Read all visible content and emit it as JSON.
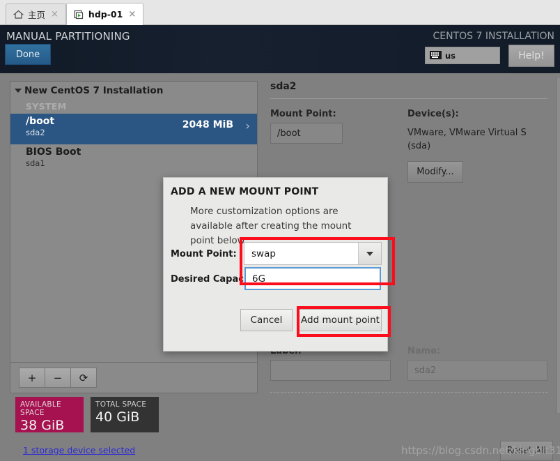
{
  "tabs": [
    {
      "label": "主页",
      "icon": "home-icon",
      "active": false,
      "close": "×"
    },
    {
      "label": "hdp-01",
      "icon": "vm-icon",
      "active": true,
      "close": "×"
    }
  ],
  "header": {
    "title": "MANUAL PARTITIONING",
    "product": "CENTOS 7 INSTALLATION",
    "done_label": "Done",
    "keyboard_layout": "us",
    "help_label": "Help!"
  },
  "partitions": {
    "group_title": "New CentOS 7 Installation",
    "section_label": "SYSTEM",
    "rows": [
      {
        "name": "/boot",
        "device": "sda2",
        "size": "2048 MiB",
        "selected": true,
        "chevron": "›"
      },
      {
        "name": "BIOS Boot",
        "device": "sda1",
        "size": "",
        "selected": false,
        "chevron": ""
      }
    ],
    "toolbar": {
      "add": "+",
      "remove": "−",
      "refresh": "⟳"
    }
  },
  "space": {
    "available_caption": "AVAILABLE SPACE",
    "available_value": "38 GiB",
    "total_caption": "TOTAL SPACE",
    "total_value": "40 GiB",
    "storage_link": "1 storage device selected",
    "available_color": "#a5124f",
    "total_color": "#333333"
  },
  "detail": {
    "title": "sda2",
    "mount_point_label": "Mount Point:",
    "mount_point_value": "/boot",
    "devices_label": "Device(s):",
    "devices_value": "VMware, VMware Virtual S (sda)",
    "modify_label": "Modify...",
    "label_label": "Label:",
    "label_value": "",
    "name_label": "Name:",
    "name_value": "sda2",
    "reset_label": "Reset All"
  },
  "dialog": {
    "title": "ADD A NEW MOUNT POINT",
    "subtitle": "More customization options are available after creating the mount point below.",
    "mount_point_label": "Mount Point:",
    "mount_point_value": "swap",
    "capacity_label": "Desired Capacity",
    "capacity_value": "6G",
    "cancel_label": "Cancel",
    "add_label": "Add mount point",
    "highlight_color": "#fc0d1b"
  },
  "watermark": "https://blog.csdn.net/kingbit311"
}
